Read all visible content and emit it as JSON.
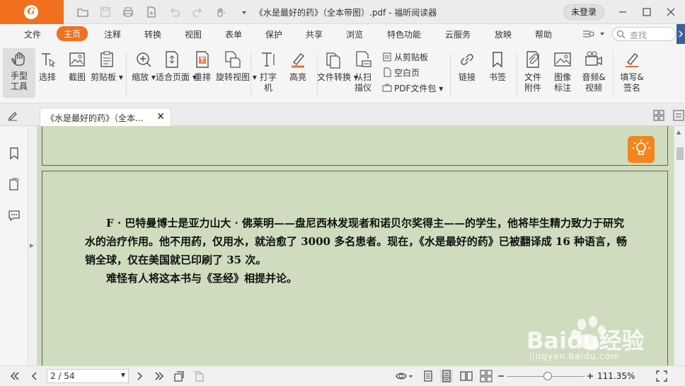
{
  "app": {
    "title": "《水是最好的药》（全本带图）.pdf - 福昕阅读器",
    "logo": "G",
    "login_label": "未登录"
  },
  "menu": {
    "items": [
      "文件",
      "主页",
      "注释",
      "转换",
      "视图",
      "表单",
      "保护",
      "共享",
      "浏览",
      "特色功能",
      "云服务",
      "放映",
      "帮助"
    ],
    "search_placeholder": "查找"
  },
  "ribbon": {
    "hand_tool": "手型工具",
    "select": "选择",
    "screenshot": "截图",
    "clipboard": "剪贴板",
    "zoom": "缩放",
    "fit_page": "适合页面",
    "reflow": "重排",
    "rotate_view": "旋转视图",
    "typewriter": "打字机",
    "highlight": "高亮",
    "file_convert": "文件转换",
    "from_scanner": "从扫描仪",
    "from_clipboard": "从剪贴板",
    "blank_page": "空白页",
    "pdf_portfolio": "PDF文件包",
    "link": "链接",
    "bookmark": "书签",
    "file_attachment": "文件附件",
    "image_annotation": "图像标注",
    "audio_video": "音频& 视频",
    "fill_sign": "填写&签名"
  },
  "tab": {
    "label": "《水是最好的药》（全本...",
    "close": "✕"
  },
  "document": {
    "paragraph1": "F · 巴特曼博士是亚力山大 · 佛莱明——盘尼西林发现者和诺贝尔奖得主——的学生，他将毕生精力致力于研究水的治疗作用。他不用药，仅用水，就治愈了 3000 多名患者。现在，《水是最好的药》已被翻译成 16 种语言，畅销全球，仅在美国就已印刷了 35 次。",
    "paragraph2": "难怪有人将这本书与《圣经》相提并论。"
  },
  "status": {
    "page_value": "2 / 54",
    "zoom_value": "111.35%",
    "zoom_fraction": 0.53
  },
  "watermark": {
    "brand": "Baidu经验",
    "url": "jingyan.baidu.com"
  },
  "colors": {
    "accent": "#f07020",
    "page_bg": "#cfdcbe",
    "bulb": "#f5841f"
  }
}
